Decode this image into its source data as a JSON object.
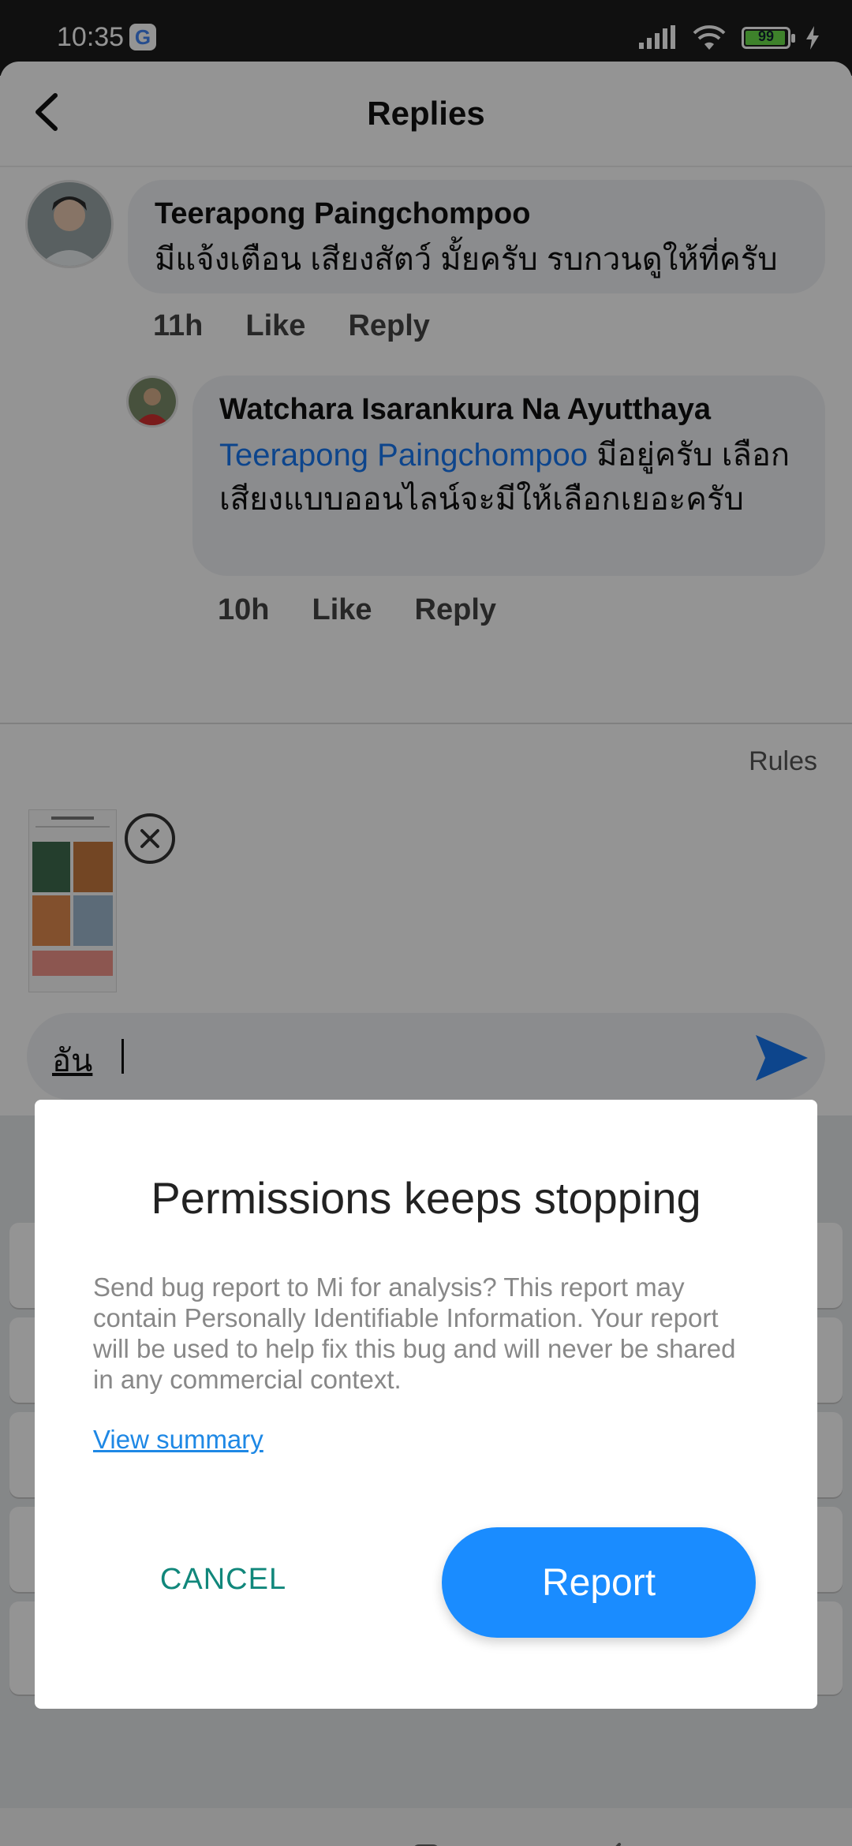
{
  "status_bar": {
    "time": "10:35",
    "google_badge": "G",
    "battery_level": "99"
  },
  "header": {
    "title": "Replies"
  },
  "comment": {
    "author": "Teerapong Paingchompoo",
    "text": "มีแจ้งเตือน เสียงสัตว์ มั้ยครับ รบกวนดูให้ที่ครับ",
    "time": "11h",
    "like_label": "Like",
    "reply_label": "Reply"
  },
  "reply": {
    "author": "Watchara Isarankura Na Ayutthaya",
    "mention": "Teerapong Paingchompoo",
    "text": " มีอยู่ครับ เลือกเสียงแบบออนไลน์จะมีให้เลือกเยอะครับ",
    "time": "10h",
    "like_label": "Like",
    "reply_label": "Reply"
  },
  "composer": {
    "rules_label": "Rules",
    "input_value": "อัน"
  },
  "dialog": {
    "title": "Permissions keeps stopping",
    "body": "Send bug report to Mi for analysis? This report may contain Personally Identifiable Information. Your report will be used to help fix this bug and will never be shared in any commercial context.",
    "link": "View summary",
    "cancel_label": "CANCEL",
    "report_label": "Report"
  },
  "colors": {
    "accent": "#1a8cff",
    "cancel": "#11877b",
    "link": "#1e88e5",
    "mention": "#1877f2"
  }
}
